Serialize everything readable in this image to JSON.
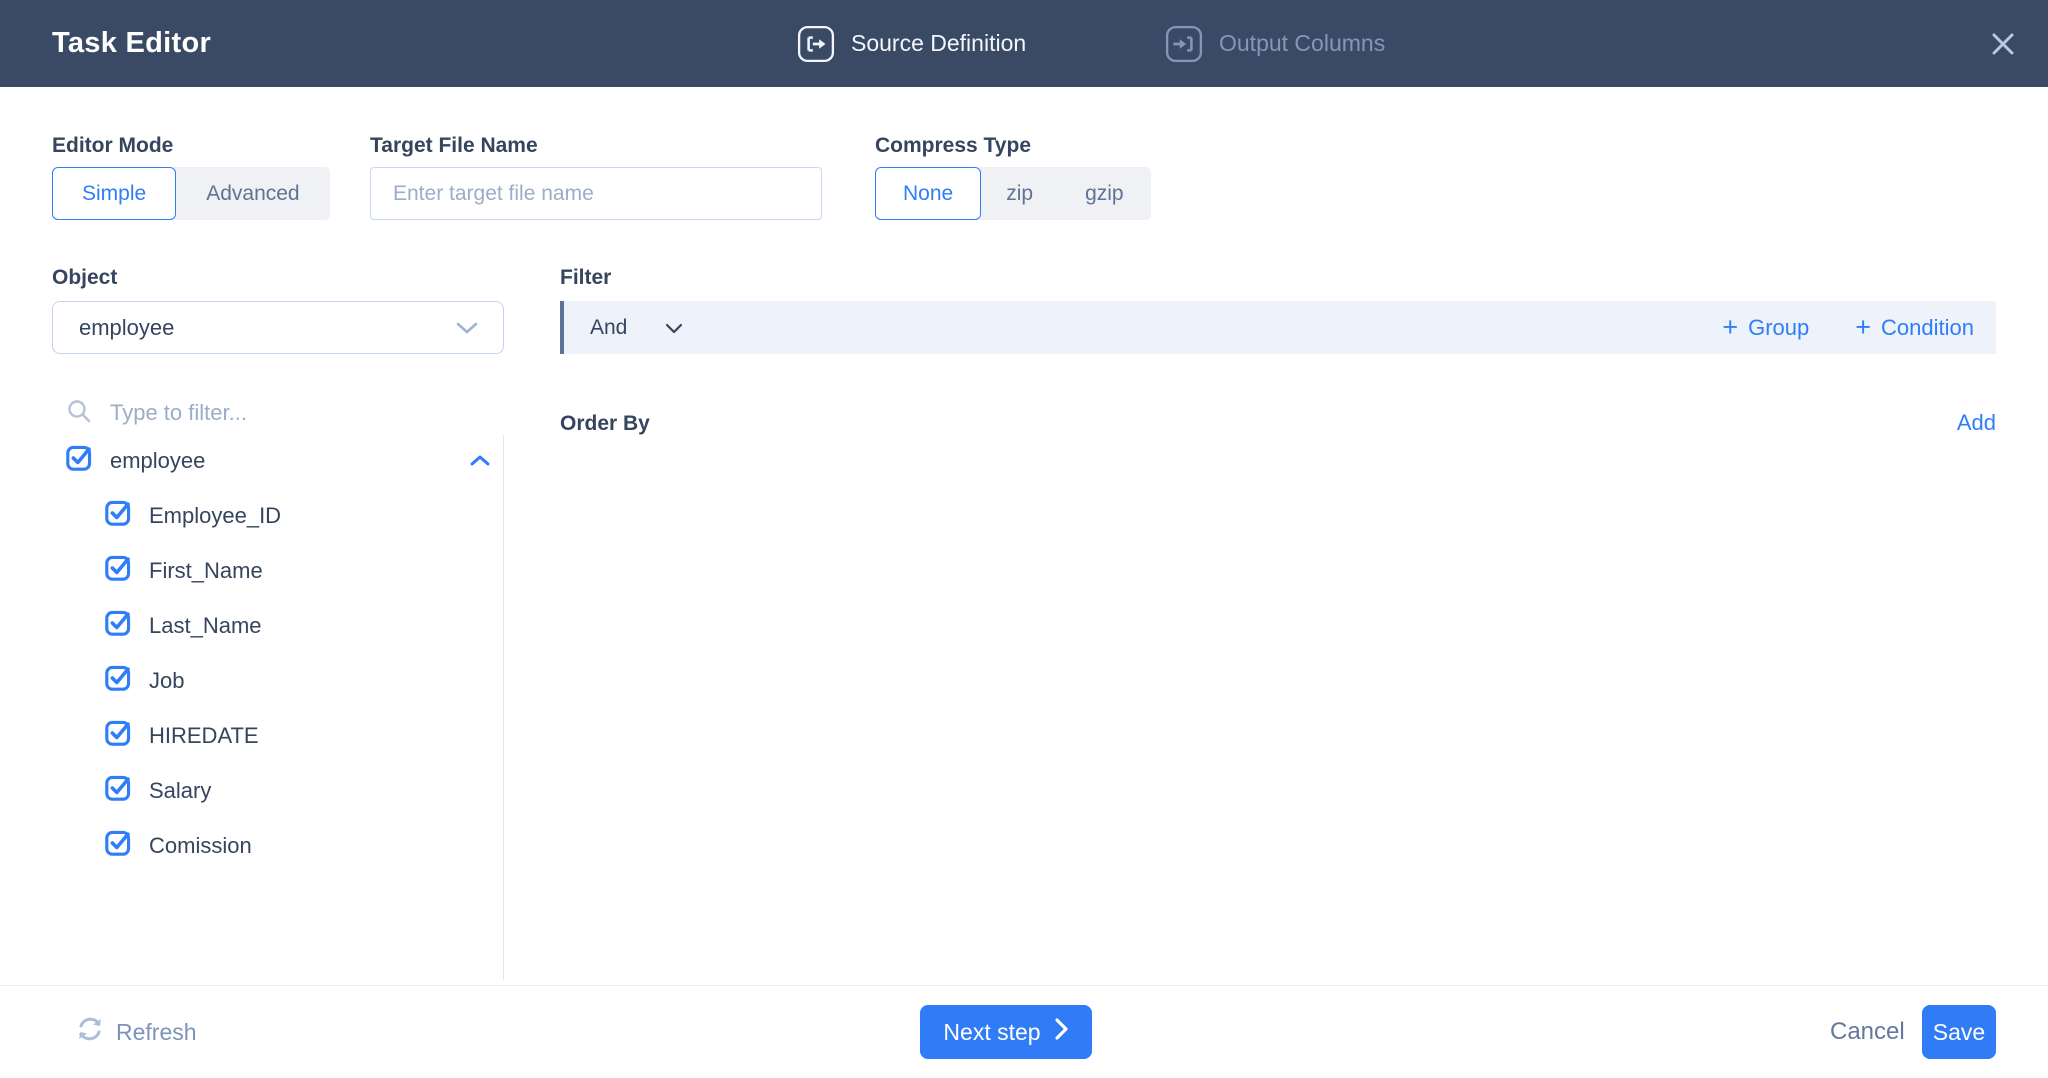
{
  "header": {
    "title": "Task Editor",
    "tabs": [
      {
        "label": "Source Definition",
        "active": true
      },
      {
        "label": "Output Columns",
        "active": false
      }
    ]
  },
  "form": {
    "editor_mode": {
      "label": "Editor Mode",
      "options": [
        "Simple",
        "Advanced"
      ],
      "selected": "Simple"
    },
    "target_file_name": {
      "label": "Target File Name",
      "value": "",
      "placeholder": "Enter target file name"
    },
    "compress_type": {
      "label": "Compress Type",
      "options": [
        "None",
        "zip",
        "gzip"
      ],
      "selected": "None"
    }
  },
  "object_panel": {
    "label": "Object",
    "selected_object": "employee",
    "search_placeholder": "Type to filter...",
    "tree": {
      "parent": {
        "label": "employee",
        "checked": true,
        "expanded": true
      },
      "children": [
        {
          "label": "Employee_ID",
          "checked": true
        },
        {
          "label": "First_Name",
          "checked": true
        },
        {
          "label": "Last_Name",
          "checked": true
        },
        {
          "label": "Job",
          "checked": true
        },
        {
          "label": "HIREDATE",
          "checked": true
        },
        {
          "label": "Salary",
          "checked": true
        },
        {
          "label": "Comission",
          "checked": true
        }
      ]
    }
  },
  "filter": {
    "label": "Filter",
    "operator": "And",
    "group_label": "Group",
    "condition_label": "Condition"
  },
  "order_by": {
    "label": "Order By",
    "add_label": "Add"
  },
  "footer": {
    "refresh_label": "Refresh",
    "next_step_label": "Next step",
    "cancel_label": "Cancel",
    "save_label": "Save"
  },
  "colors": {
    "accent_blue": "#2f7ef7",
    "header_bg": "#3b4a64",
    "filter_bar_bg": "#eef2fb",
    "filter_bar_border": "#5f7398",
    "inactive_tab": "#8496ba",
    "dark_text": "#36455e"
  }
}
